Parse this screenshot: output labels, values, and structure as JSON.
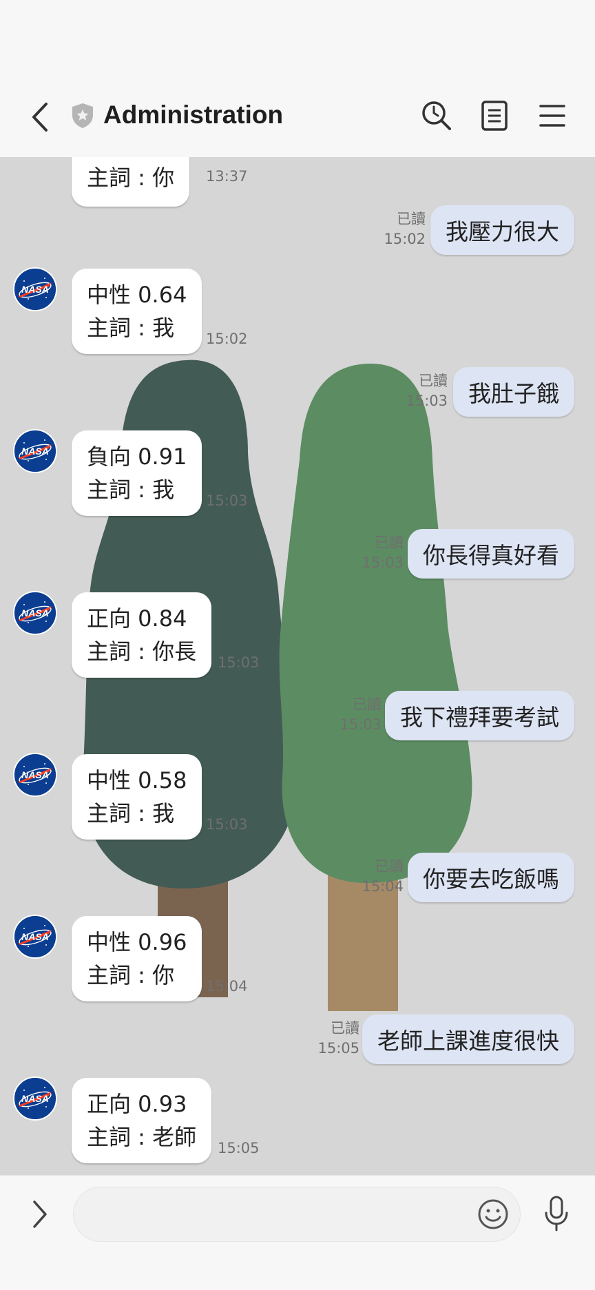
{
  "header": {
    "title": "Administration",
    "icons": [
      "back-arrow-icon",
      "shield-icon",
      "search-icon",
      "notes-icon",
      "menu-icon"
    ]
  },
  "chat": {
    "read_label": "已讀",
    "incoming": [
      {
        "line2": "主詞 : 你",
        "time": "13:37"
      },
      {
        "line1": "中性 0.64",
        "line2": "主詞 : 我",
        "time": "15:02"
      },
      {
        "line1": "負向 0.91",
        "line2": "主詞 : 我",
        "time": "15:03"
      },
      {
        "line1": "正向 0.84",
        "line2": "主詞 : 你長",
        "time": "15:03"
      },
      {
        "line1": "中性 0.58",
        "line2": "主詞 : 我",
        "time": "15:03"
      },
      {
        "line1": "中性 0.96",
        "line2": "主詞 : 你",
        "time": "15:04"
      },
      {
        "line1": "正向 0.93",
        "line2": "主詞 : 老師",
        "time": "15:05"
      }
    ],
    "outgoing": [
      {
        "text": "我壓力很大",
        "time": "15:02"
      },
      {
        "text": "我肚子餓",
        "time": "15:03"
      },
      {
        "text": "你長得真好看",
        "time": "15:03"
      },
      {
        "text": "我下禮拜要考試",
        "time": "15:03"
      },
      {
        "text": "你要去吃飯嗎",
        "time": "15:04"
      },
      {
        "text": "老師上課進度很快",
        "time": "15:05"
      }
    ],
    "avatar_logo_text": "NASA"
  },
  "input": {
    "placeholder": "",
    "icons": [
      "expand-arrow-icon",
      "emoji-icon",
      "microphone-icon"
    ]
  },
  "colors": {
    "chat_background": "#d6d6d6",
    "outgoing_bubble": "#dde4f4",
    "incoming_bubble": "#ffffff",
    "bar_background": "#f7f7f7"
  }
}
